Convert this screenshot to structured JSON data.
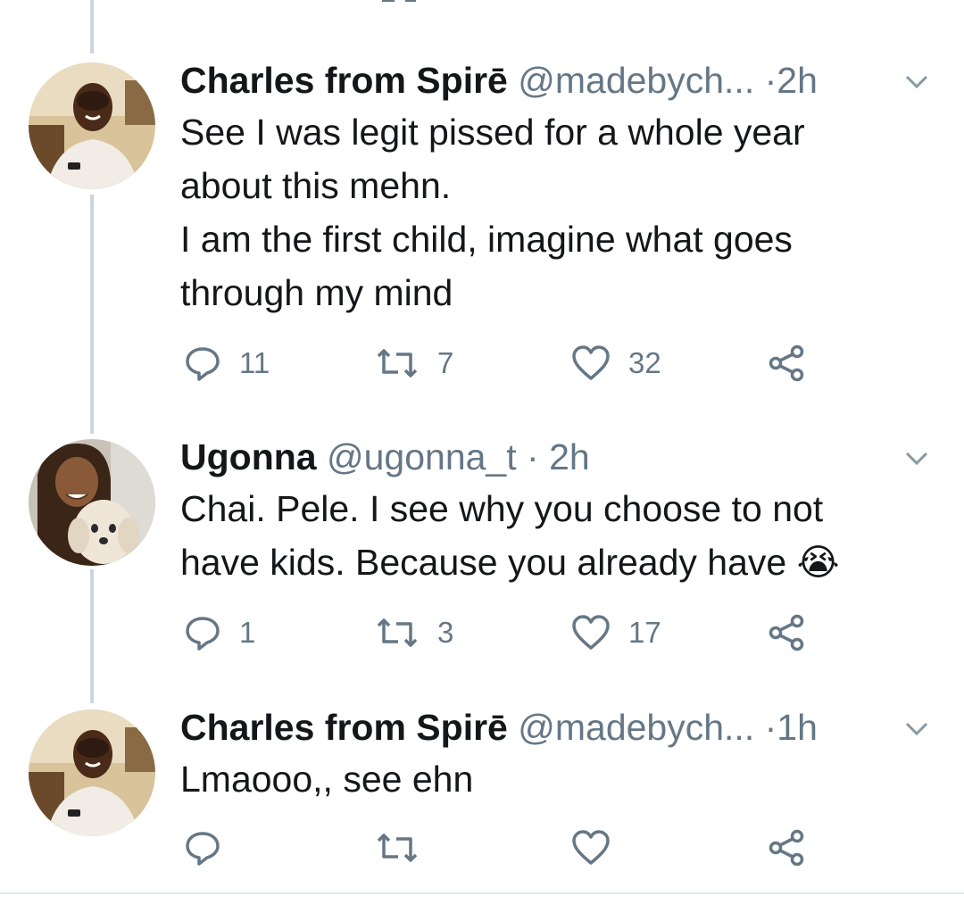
{
  "thread": {
    "tweets": [
      {
        "name": "Charles from Spirē",
        "handle": "@madebych...",
        "dot": "·",
        "time": "2h",
        "lines": [
          "See I was legit pissed for a whole year",
          "about this mehn.",
          "I am the first child, imagine what goes",
          "through my mind"
        ],
        "replies": "11",
        "retweets": "7",
        "likes": "32"
      },
      {
        "name": "Ugonna",
        "handle": "@ugonna_t",
        "dot": "·",
        "time": "2h",
        "lines": [
          "Chai. Pele. I see why you choose to not",
          "have kids. Because you already have"
        ],
        "emoji": "😭",
        "replies": "1",
        "retweets": "3",
        "likes": "17"
      },
      {
        "name": "Charles from Spirē",
        "handle": "@madebych...",
        "dot": "·",
        "time": "1h",
        "lines": [
          "Lmaooo,, see ehn"
        ],
        "replies": "",
        "retweets": "",
        "likes": ""
      }
    ]
  },
  "colors": {
    "text": "#14171a",
    "secondary": "#657786",
    "thread_line": "#ccd6dd"
  },
  "icons": [
    "reply-icon",
    "retweet-icon",
    "like-icon",
    "share-icon",
    "chevron-down-icon"
  ]
}
